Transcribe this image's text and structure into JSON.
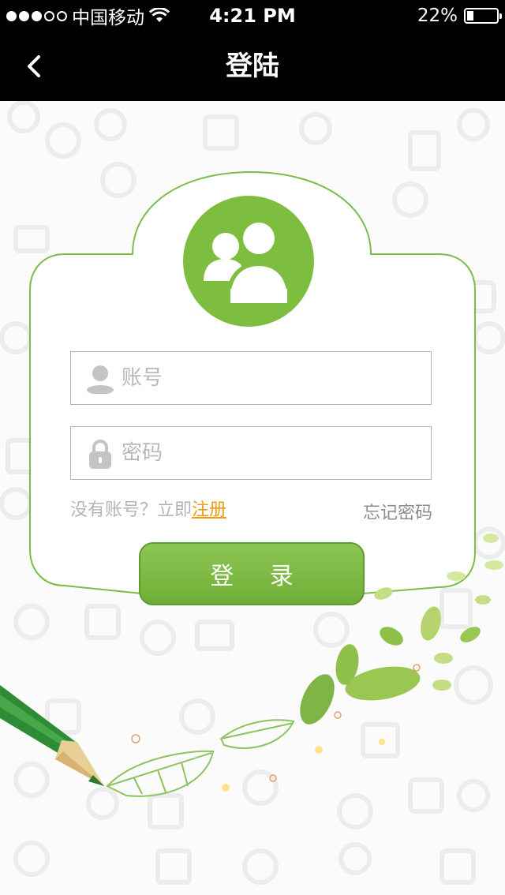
{
  "status_bar": {
    "carrier": "中国移动",
    "time": "4:21 PM",
    "battery": "22%",
    "battery_level": 0.22,
    "signal_bars_on": 3,
    "signal_bars_total": 5
  },
  "nav": {
    "title": "登陆"
  },
  "login": {
    "username_placeholder": "账号",
    "password_placeholder": "密码",
    "no_account_text": "没有账号？立即",
    "register_link": "注册",
    "forgot_password": "忘记密码",
    "login_button": "登 录"
  },
  "colors": {
    "accent": "#7dbe40",
    "link": "#f39a16"
  },
  "icons": {
    "back": "chevron-left-icon",
    "avatar": "users-icon",
    "username": "user-icon",
    "password": "lock-icon"
  }
}
